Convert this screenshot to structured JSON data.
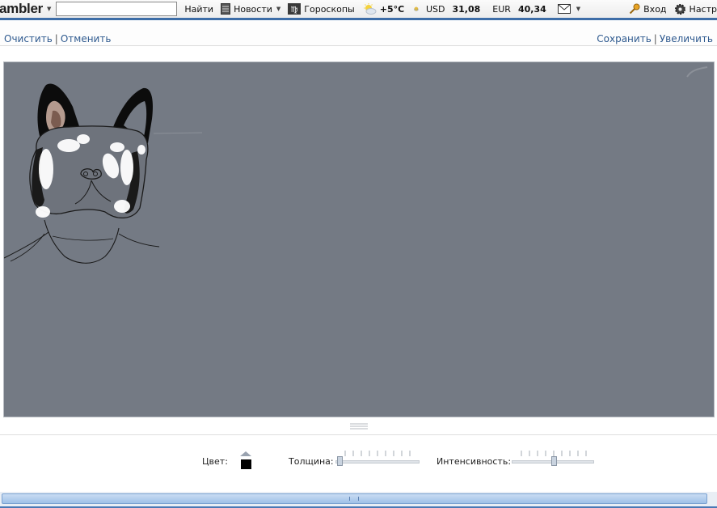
{
  "toolbar": {
    "logo": "ambler",
    "search_value": "",
    "find_label": "Найти",
    "news_label": "Новости",
    "horoscopes_label": "Гороскопы",
    "weather": "+5°C",
    "usd_label": "USD",
    "usd_value": "31,08",
    "eur_label": "EUR",
    "eur_value": "40,34",
    "login_label": "Вход",
    "settings_label": "Настр"
  },
  "actions": {
    "clear": "Очистить",
    "undo": "Отменить",
    "separator": "|",
    "save": "Сохранить",
    "zoom": "Увеличить"
  },
  "canvas": {
    "background": "#747a84",
    "brush_color": "#000000"
  },
  "controls": {
    "color_label": "Цвет:",
    "thickness_label": "Толщина:",
    "intensity_label": "Интенсивность:",
    "thickness_value": 0.0,
    "intensity_value": 0.5
  },
  "colors": {
    "accent": "#3d6da7",
    "link": "#2f5a8f"
  }
}
